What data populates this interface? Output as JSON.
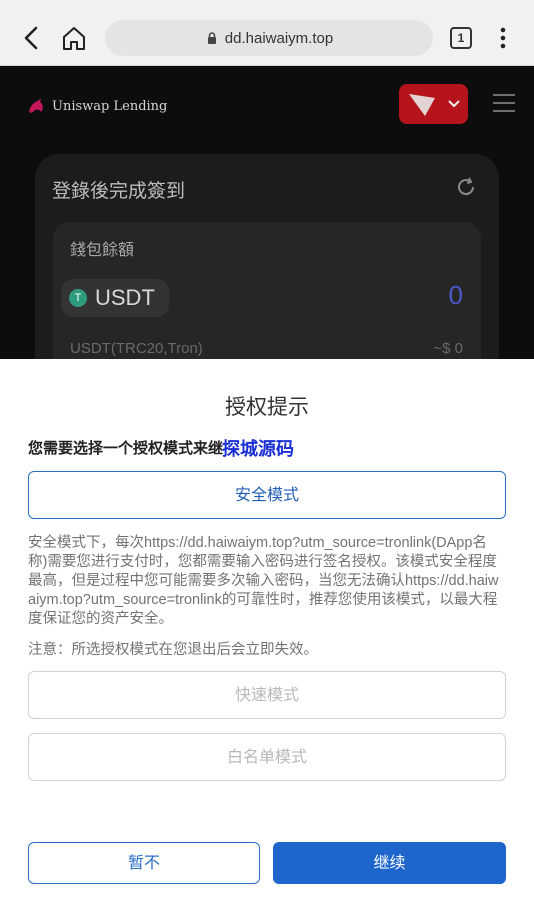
{
  "browser": {
    "url": "dd.haiwaiym.top",
    "tab_count": "1"
  },
  "app": {
    "brand_name": "Uniswap Lending",
    "card_title": "登錄後完成簽到",
    "wallet_label": "錢包餘額",
    "token": {
      "symbol": "USDT",
      "icon_letter": "T",
      "amount": "0",
      "chain": "USDT(TRC20,Tron)",
      "value": "~$ 0"
    }
  },
  "dialog": {
    "title": "授权提示",
    "subtitle": "您需要选择一个授权模式来继",
    "watermark": "探城源码",
    "modes": {
      "safe": "安全模式",
      "fast": "快速模式",
      "whitelist": "白名单模式"
    },
    "description": "安全模式下，每次https://dd.haiwaiym.top?utm_source=tronlink(DApp名称)需要您进行支付时，您都需要输入密码进行签名授权。该模式安全程度最高，但是过程中您可能需要多次输入密码，当您无法确认https://dd.haiwaiym.top?utm_source=tronlink的可靠性时，推荐您使用该模式，以最大程度保证您的资产安全。",
    "note": "注意：所选授权模式在您退出后会立即失效。",
    "buttons": {
      "later": "暂不",
      "continue": "继续"
    }
  },
  "colors": {
    "primary": "#1e66cc",
    "network_red": "#b5141c",
    "amount_blue": "#4a5ac9",
    "watermark": "#1a2fd6"
  }
}
